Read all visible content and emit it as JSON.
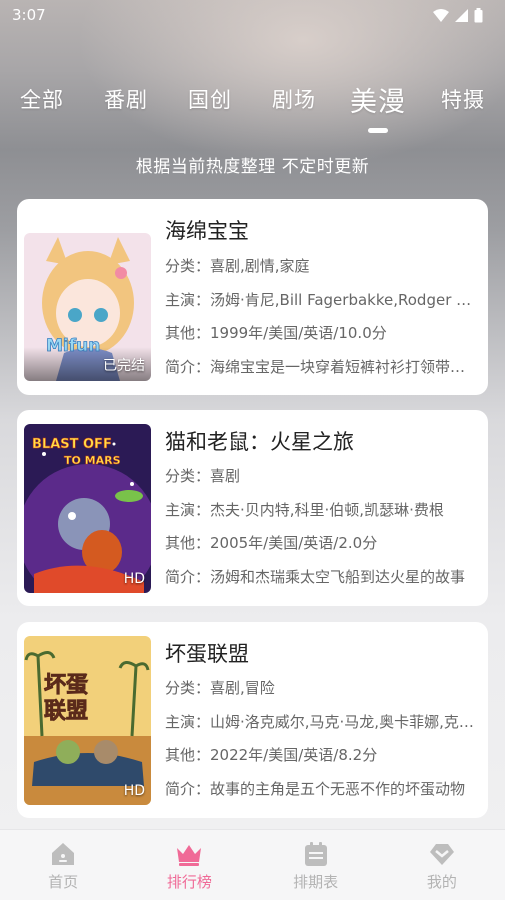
{
  "status_bar": {
    "time": "3:07"
  },
  "tabs": [
    {
      "label": "全部"
    },
    {
      "label": "番剧"
    },
    {
      "label": "国创"
    },
    {
      "label": "剧场"
    },
    {
      "label": "美漫",
      "active": true
    },
    {
      "label": "特摄"
    }
  ],
  "subtitle": "根据当前热度整理 不定时更新",
  "items": [
    {
      "title": "海绵宝宝",
      "category": "分类：喜剧,剧情,家庭",
      "cast": "主演：汤姆·肯尼,Bill Fagerbakke,Rodger Bumpass",
      "other": "其他：1999年/美国/英语/10.0分",
      "intro": "简介：海绵宝宝是一块穿着短裤衬衫打领带的海绵",
      "badge": "已完结",
      "cover_text": "Mifun"
    },
    {
      "title": "猫和老鼠：火星之旅",
      "category": "分类：喜剧",
      "cast": "主演：杰夫·贝内特,科里·伯顿,凯瑟琳·费根",
      "other": "其他：2005年/美国/英语/2.0分",
      "intro": "简介：汤姆和杰瑞乘太空飞船到达火星的故事",
      "badge": "HD",
      "cover_text": "BLAST OFF TO MARS"
    },
    {
      "title": "坏蛋联盟",
      "category": "分类：喜剧,冒险",
      "cast": "主演：山姆·洛克威尔,马克·马龙,奥卡菲娜,克雷格",
      "other": "其他：2022年/美国/英语/8.2分",
      "intro": "简介：故事的主角是五个无恶不作的坏蛋动物",
      "badge": "HD",
      "cover_text": "坏蛋联盟"
    }
  ],
  "bottom_nav": [
    {
      "label": "首页",
      "icon": "home-icon"
    },
    {
      "label": "排行榜",
      "icon": "crown-icon",
      "active": true
    },
    {
      "label": "排期表",
      "icon": "calendar-icon"
    },
    {
      "label": "我的",
      "icon": "heart-icon"
    }
  ],
  "colors": {
    "accent": "#f06a97",
    "inactive": "#b3b3b3"
  }
}
